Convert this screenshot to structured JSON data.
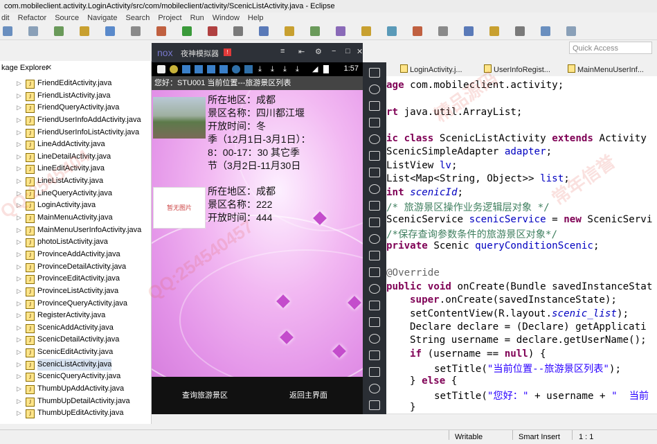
{
  "window": {
    "title": "com.mobileclient.activity.LoginActivity/src/com/mobileclient/activity/ScenicListActivity.java - Eclipse"
  },
  "menu": [
    "dit",
    "Refactor",
    "Source",
    "Navigate",
    "Search",
    "Project",
    "Run",
    "Window",
    "Help"
  ],
  "quick_access": {
    "placeholder": "Quick Access"
  },
  "explorer": {
    "tab_label": "kage Explorer",
    "close": "✕",
    "files": [
      "FriendEditActivity.java",
      "FriendListActivity.java",
      "FriendQueryActivity.java",
      "FriendUserInfoAddActivity.java",
      "FriendUserInfoListActivity.java",
      "LineAddActivity.java",
      "LineDetailActivity.java",
      "LineEditActivity.java",
      "LineListActivity.java",
      "LineQueryActivity.java",
      "LoginActivity.java",
      "MainMenuActivity.java",
      "MainMenuUserInfoActivity.java",
      "photoListActivity.java",
      "ProvinceAddActivity.java",
      "ProvinceDetailActivity.java",
      "ProvinceEditActivity.java",
      "ProvinceListActivity.java",
      "ProvinceQueryActivity.java",
      "RegisterActivity.java",
      "ScenicAddActivity.java",
      "ScenicDetailActivity.java",
      "ScenicEditActivity.java",
      "ScenicListActivity.java",
      "ScenicQueryActivity.java",
      "ThumbUpAddActivity.java",
      "ThumbUpDetailActivity.java",
      "ThumbUpEditActivity.java"
    ],
    "selected_file": "ScenicListActivity.java"
  },
  "emulator": {
    "logo": "nox",
    "name": "夜神模拟器",
    "badge": "!",
    "time": "1:57",
    "app_title": "您好：STU001  当前位置---旅游景区列表",
    "items": [
      {
        "thumb": "photo",
        "lines": [
          "所在地区：成都",
          "景区名称：四川都江堰",
          "开放时间：冬",
          "季（12月1日-3月1日）：",
          "8：00-17：30 其它季",
          "节（3月2日-11月30日"
        ]
      },
      {
        "thumb": "empty",
        "thumb_text": "暂无图片",
        "lines": [
          "所在地区：成都",
          "景区名称：222",
          "开放时间：444"
        ]
      }
    ],
    "footer": {
      "query": "查询旅游景区",
      "back": "返回主界面"
    }
  },
  "editor": {
    "tabs": [
      "LoginActivity.j...",
      "UserInfoRegist...",
      "MainMenuUserInf..."
    ],
    "code": {
      "l1_kw": "age",
      "l1_rest": " com.mobileclient.activity;",
      "l2_kw": "rt",
      "l2_rest": " java.util.ArrayList;",
      "l3_kw1": "ic class",
      "l3_name": " ScenicListActivity ",
      "l3_kw2": "extends",
      "l3_rest": " Activity",
      "l4_type": "ScenicSimpleAdapter ",
      "l4_fld": "adapter",
      "l4_end": ";",
      "l5_type": "ListView ",
      "l5_fld": "lv",
      "l5_end": ";",
      "l6_type": "List<Map<String, Object>> ",
      "l6_fld": "list",
      "l6_end": ";",
      "l7_kw": "int ",
      "l7_fld": "scenicId",
      "l7_end": ";",
      "l8_cmt": "/* 旅游景区操作业务逻辑层对象 */",
      "l9_type": "ScenicService ",
      "l9_fld": "scenicService",
      "l9_mid": " = ",
      "l9_kw": "new",
      "l9_rest": " ScenicServi",
      "l10_cmt": "/*保存查询参数条件的旅游景区对象*/",
      "l11_kw": "private",
      "l11_type": " Scenic ",
      "l11_fld": "queryConditionScenic",
      "l11_end": ";",
      "l13_ann": "@Override",
      "l14_kw1": "public",
      "l14_kw2": " void",
      "l14_rest": " onCreate(Bundle savedInstanceStat",
      "l15_kw": "super",
      "l15_rest": ".onCreate(savedInstanceState);",
      "l16_pre": "setContentView(R.layout.",
      "l16_it": "scenic_list",
      "l16_end": ");",
      "l17_rest": "Declare declare = (Declare) getApplicati",
      "l18_rest": "String username = declare.getUserName();",
      "l19_kw1": "if",
      "l19_mid": " (username == ",
      "l19_kw2": "null",
      "l19_end": ") {",
      "l20_pre": "setTitle(",
      "l20_str": "\"当前位置--旅游景区列表\"",
      "l20_end": ");",
      "l21_pre": "} ",
      "l21_kw": "else",
      "l21_end": " {",
      "l22_pre": "setTitle(",
      "l22_str": "\"您好：\"",
      "l22_mid": " + username + ",
      "l22_str2": "\"  当前",
      "l23": "}"
    }
  },
  "status": {
    "writable": "Writable",
    "insert": "Smart Insert",
    "position": "1 : 1"
  },
  "watermarks": [
    "QQ:2545404",
    "精品源码",
    "常年信誉",
    "QQ:254540457"
  ]
}
